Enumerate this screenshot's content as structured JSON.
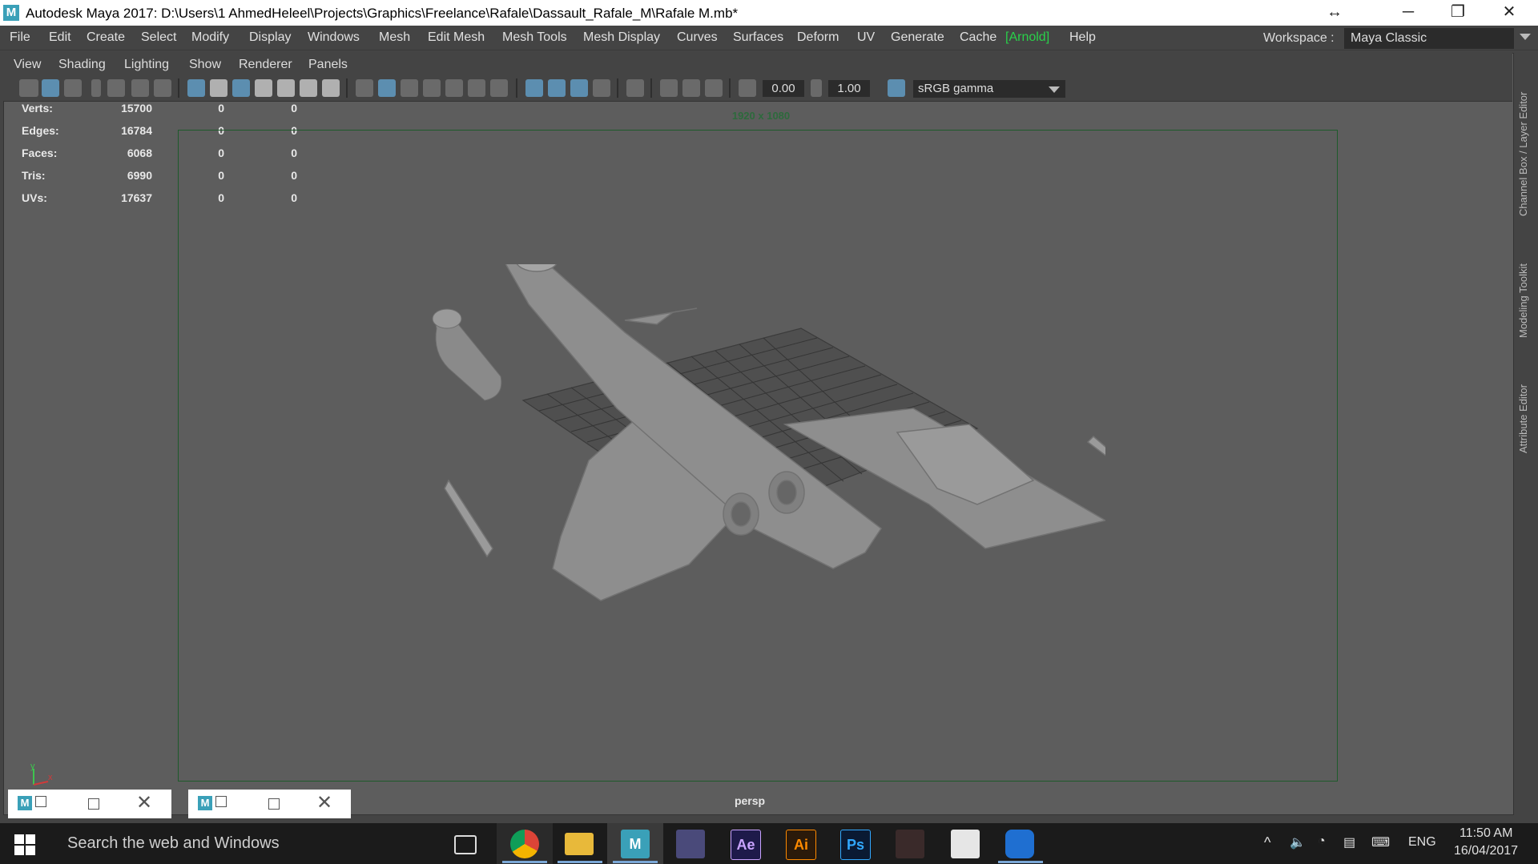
{
  "window": {
    "title": "Autodesk Maya 2017: D:\\Users\\1 AhmedHeleel\\Projects\\Graphics\\Freelance\\Rafale\\Dassault_Rafale_M\\Rafale M.mb*",
    "app_icon": "M"
  },
  "menubar": {
    "items": [
      "File",
      "Edit",
      "Create",
      "Select",
      "Modify",
      "Display",
      "Windows",
      "Mesh",
      "Edit Mesh",
      "Mesh Tools",
      "Mesh Display",
      "Curves",
      "Surfaces",
      "Deform",
      "UV",
      "Generate",
      "Cache",
      "[Arnold]",
      "Help"
    ],
    "workspace_label": "Workspace :",
    "workspace_value": "Maya Classic"
  },
  "panel": {
    "menu": [
      "View",
      "Shading",
      "Lighting",
      "Show",
      "Renderer",
      "Panels"
    ],
    "toolbar": {
      "field1": "0.00",
      "field2": "1.00",
      "color_space": "sRGB gamma"
    },
    "hud": {
      "rows": [
        {
          "label": "Verts:",
          "total": "15700",
          "sel": "0",
          "comp": "0"
        },
        {
          "label": "Edges:",
          "total": "16784",
          "sel": "0",
          "comp": "0"
        },
        {
          "label": "Faces:",
          "total": "6068",
          "sel": "0",
          "comp": "0"
        },
        {
          "label": "Tris:",
          "total": "6990",
          "sel": "0",
          "comp": "0"
        },
        {
          "label": "UVs:",
          "total": "17637",
          "sel": "0",
          "comp": "0"
        }
      ]
    },
    "resolution_gate": "1920 x 1080",
    "camera": "persp",
    "axis": {
      "y": "y",
      "x": "x"
    }
  },
  "side_tabs": [
    "Channel Box / Layer Editor",
    "Modeling Toolkit",
    "Attribute Editor"
  ],
  "mini_windows": [
    {
      "icon": "M"
    },
    {
      "icon": "M"
    }
  ],
  "taskbar": {
    "search_placeholder": "Search the web and Windows",
    "apps": [
      {
        "name": "task-view",
        "label": ""
      },
      {
        "name": "chrome",
        "label": ""
      },
      {
        "name": "file-explorer",
        "label": ""
      },
      {
        "name": "maya",
        "label": "M"
      },
      {
        "name": "game",
        "label": ""
      },
      {
        "name": "after-effects",
        "label": "Ae"
      },
      {
        "name": "illustrator",
        "label": "Ai"
      },
      {
        "name": "photoshop",
        "label": "Ps"
      },
      {
        "name": "app-red",
        "label": ""
      },
      {
        "name": "zbrush",
        "label": ""
      },
      {
        "name": "teamviewer",
        "label": ""
      }
    ],
    "language": "ENG",
    "time": "11:50 AM",
    "date": "16/04/2017"
  },
  "colors": {
    "arnold": "#29d14a",
    "viewport_bg": "#5d5d5d",
    "gate_border": "#1e5a2b"
  }
}
